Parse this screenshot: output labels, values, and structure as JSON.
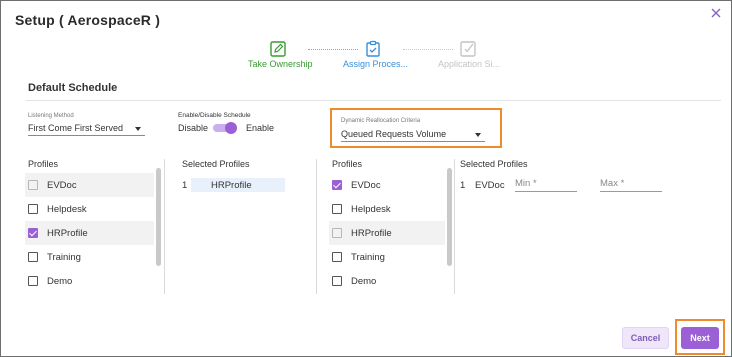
{
  "dialog": {
    "title": "Setup ( AerospaceR )"
  },
  "stepper": {
    "steps": [
      {
        "label": "Take Ownership",
        "state": "done",
        "icon": "edit-icon",
        "color": "#3a9b33"
      },
      {
        "label": "Assign Proces...",
        "state": "active",
        "icon": "clipboard-check-icon",
        "color": "#3a8fd8"
      },
      {
        "label": "Application Si...",
        "state": "disabled",
        "icon": "edit-check-icon",
        "color": "#c4c4c4"
      }
    ]
  },
  "section": {
    "title": "Default Schedule"
  },
  "listening_method": {
    "label": "Listening Method",
    "value": "First Come First Served"
  },
  "schedule_toggle": {
    "label": "Enable/Disable Schedule",
    "off_label": "Disable",
    "on_label": "Enable",
    "enabled": true
  },
  "reallocation": {
    "label": "Dynamic Reallocation Criteria",
    "value": "Queued Requests Volume"
  },
  "left_panel": {
    "profiles_header": "Profiles",
    "profiles": [
      {
        "label": "EVDoc",
        "checked": false,
        "disabled": true
      },
      {
        "label": "Helpdesk",
        "checked": false,
        "disabled": false
      },
      {
        "label": "HRProfile",
        "checked": true,
        "disabled": false
      },
      {
        "label": "Training",
        "checked": false,
        "disabled": false
      },
      {
        "label": "Demo",
        "checked": false,
        "disabled": false
      }
    ],
    "selected_header": "Selected Profiles",
    "selected": [
      {
        "index": "1",
        "name": "HRProfile"
      }
    ]
  },
  "right_panel": {
    "profiles_header": "Profiles",
    "profiles": [
      {
        "label": "EVDoc",
        "checked": true,
        "disabled": false
      },
      {
        "label": "Helpdesk",
        "checked": false,
        "disabled": false
      },
      {
        "label": "HRProfile",
        "checked": false,
        "disabled": true
      },
      {
        "label": "Training",
        "checked": false,
        "disabled": false
      },
      {
        "label": "Demo",
        "checked": false,
        "disabled": false
      }
    ],
    "selected_header": "Selected Profiles",
    "selected": [
      {
        "index": "1",
        "name": "EVDoc",
        "min_placeholder": "Min *",
        "max_placeholder": "Max *"
      }
    ]
  },
  "footer": {
    "cancel_label": "Cancel",
    "next_label": "Next"
  },
  "colors": {
    "accent": "#9b5fd6",
    "highlight_outline": "#ef8a2e"
  }
}
